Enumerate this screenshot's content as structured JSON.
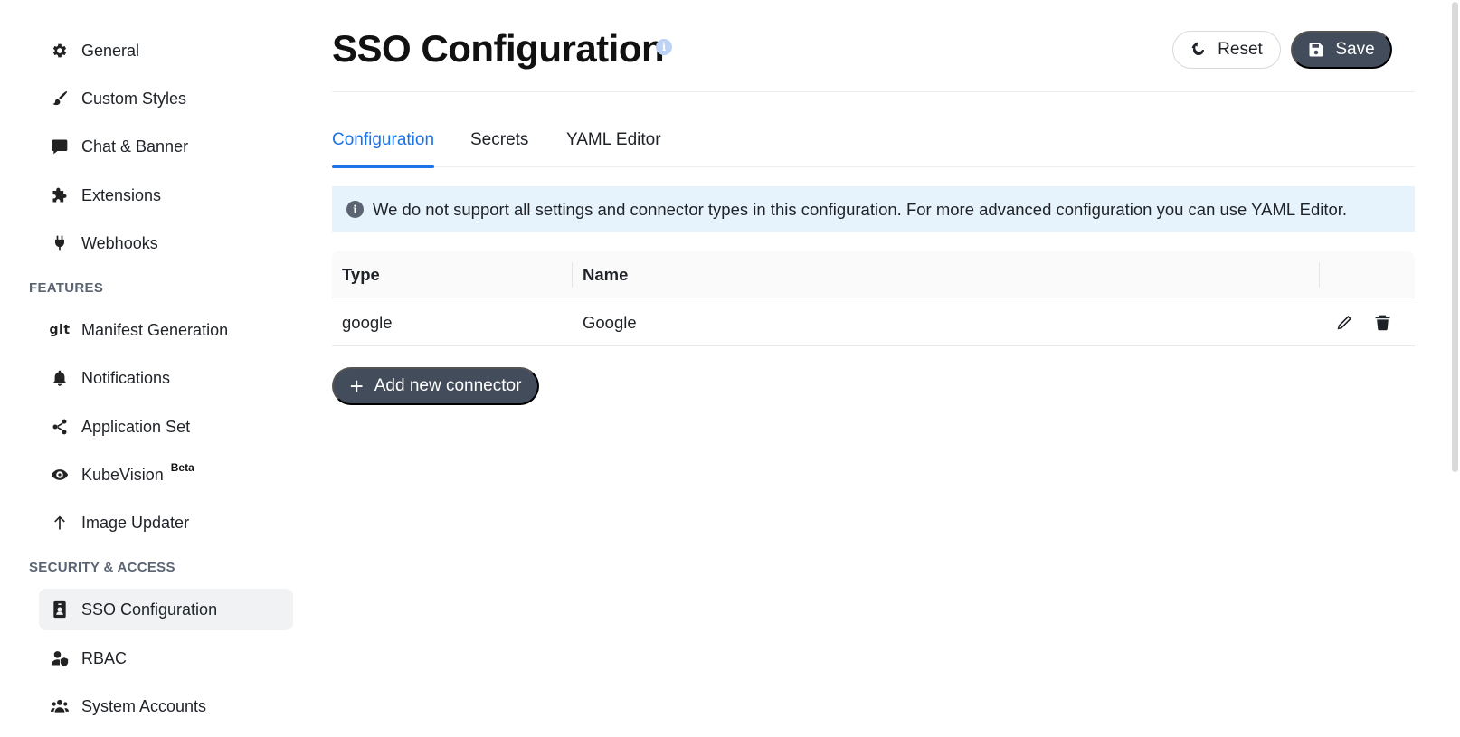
{
  "sidebar": {
    "items_top": [
      {
        "label": "General",
        "icon": "gear-icon"
      },
      {
        "label": "Custom Styles",
        "icon": "paintbrush-icon"
      },
      {
        "label": "Chat & Banner",
        "icon": "chat-bubble-icon"
      },
      {
        "label": "Extensions",
        "icon": "puzzle-icon"
      },
      {
        "label": "Webhooks",
        "icon": "plug-icon"
      }
    ],
    "features_header": "FEATURES",
    "features": [
      {
        "label": "Manifest Generation",
        "icon": "git-icon",
        "icon_text": "git"
      },
      {
        "label": "Notifications",
        "icon": "bell-icon"
      },
      {
        "label": "Application Set",
        "icon": "share-nodes-icon"
      },
      {
        "label": "KubeVision",
        "icon": "eye-icon",
        "badge": "Beta"
      },
      {
        "label": "Image Updater",
        "icon": "arrow-up-icon"
      }
    ],
    "security_header": "SECURITY & ACCESS",
    "security": [
      {
        "label": "SSO Configuration",
        "icon": "id-badge-icon",
        "active": true
      },
      {
        "label": "RBAC",
        "icon": "user-shield-icon"
      },
      {
        "label": "System Accounts",
        "icon": "users-icon"
      }
    ]
  },
  "header": {
    "title": "SSO Configuration",
    "info_glyph": "i",
    "reset_label": "Reset",
    "save_label": "Save"
  },
  "tabs": [
    {
      "label": "Configuration",
      "active": true
    },
    {
      "label": "Secrets",
      "active": false
    },
    {
      "label": "YAML Editor",
      "active": false
    }
  ],
  "alert": {
    "glyph": "i",
    "text": "We do not support all settings and connector types in this configuration. For more advanced configuration you can use YAML Editor."
  },
  "table": {
    "columns": [
      "Type",
      "Name"
    ],
    "rows": [
      {
        "type": "google",
        "name": "Google"
      }
    ]
  },
  "add_connector_label": "Add new connector",
  "colors": {
    "accent": "#1a73e8",
    "button_dark": "#434c5a",
    "alert_bg": "#e6f3fd",
    "active_nav_bg": "#f1f2f4"
  }
}
